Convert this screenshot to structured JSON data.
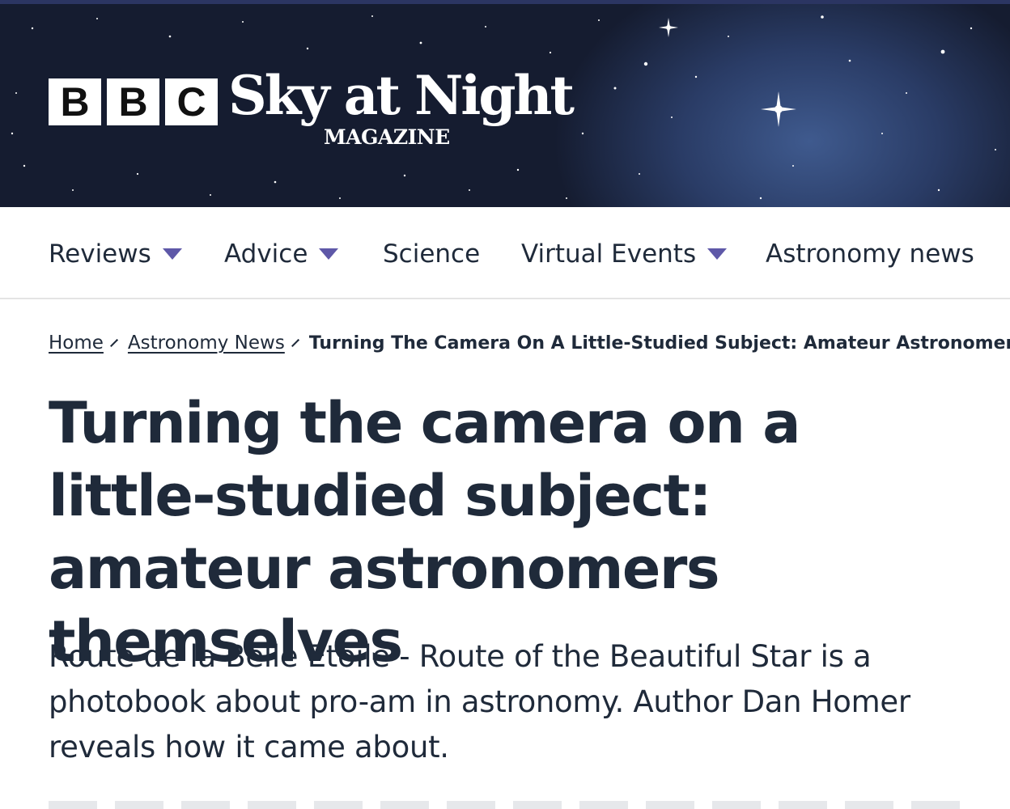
{
  "header": {
    "logo": {
      "bbc_letters": [
        "B",
        "B",
        "C"
      ],
      "title": "Sky at Night",
      "subtitle": "MAGAZINE"
    }
  },
  "nav": {
    "items": [
      {
        "label": "Reviews",
        "has_dropdown": true
      },
      {
        "label": "Advice",
        "has_dropdown": true
      },
      {
        "label": "Science",
        "has_dropdown": false
      },
      {
        "label": "Virtual Events",
        "has_dropdown": true
      },
      {
        "label": "Astronomy news",
        "has_dropdown": false
      }
    ]
  },
  "breadcrumb": {
    "home": "Home",
    "section": "Astronomy News",
    "current": "Turning The Camera On A Little-Studied Subject: Amateur Astronomers Themselves"
  },
  "article": {
    "headline": "Turning the camera on a little-studied subject: amateur astronomers themselves",
    "standfirst": "Route de la Belle Etoile - Route of the Beautiful Star is a photobook about pro-am in astronomy. Author Dan Homer reveals how it came about."
  },
  "colors": {
    "text": "#1f2a3a",
    "accent_caret": "#5e58a8",
    "banner_dark": "#1a1a1e",
    "banner_blue": "#3f5a8e"
  }
}
